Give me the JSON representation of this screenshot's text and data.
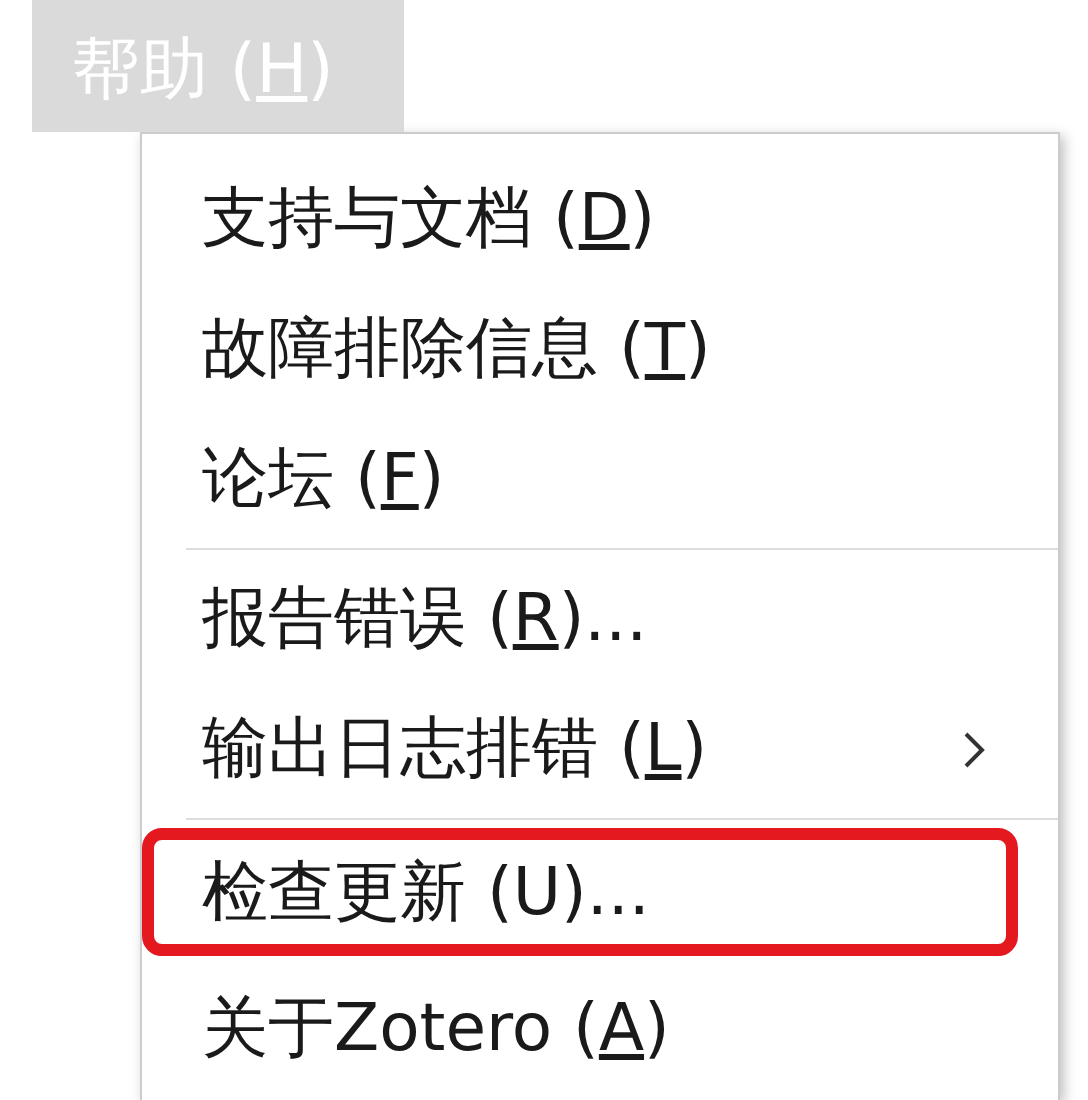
{
  "menubar": {
    "prefix": "帮助 (",
    "key": "H",
    "suffix": ")",
    "selected": true
  },
  "menu": {
    "items": [
      {
        "kind": "item",
        "prefix": "支持与文档 (",
        "key": "D",
        "suffix": ")",
        "submenu": false,
        "highlighted": false
      },
      {
        "kind": "item",
        "prefix": "故障排除信息 (",
        "key": "T",
        "suffix": ")",
        "submenu": false,
        "highlighted": false
      },
      {
        "kind": "item",
        "prefix": "论坛 (",
        "key": "F",
        "suffix": ")",
        "submenu": false,
        "highlighted": false
      },
      {
        "kind": "separator"
      },
      {
        "kind": "item",
        "prefix": "报告错误 (",
        "key": "R",
        "suffix": ")...",
        "submenu": false,
        "highlighted": false
      },
      {
        "kind": "item",
        "prefix": "输出日志排错 (",
        "key": "L",
        "suffix": ")",
        "submenu": true,
        "highlighted": false
      },
      {
        "kind": "separator"
      },
      {
        "kind": "item",
        "prefix": "检查更新 (U)...",
        "submenu": false,
        "highlighted": true
      },
      {
        "kind": "item",
        "prefix": "关于Zotero (",
        "key": "A",
        "suffix": ")",
        "submenu": false,
        "highlighted": false
      }
    ]
  }
}
